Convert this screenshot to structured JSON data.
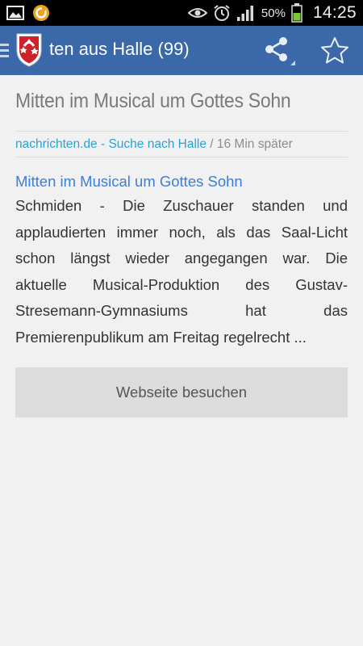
{
  "status_bar": {
    "battery_percent": "50%",
    "time": "14:25",
    "icons": [
      "gallery-icon",
      "app-notification-icon",
      "eye-icon",
      "alarm-icon",
      "signal-icon",
      "battery-icon"
    ]
  },
  "action_bar": {
    "title": "ten aus Halle (99)",
    "logo": "halle-coat-of-arms-logo",
    "actions": [
      "share-icon",
      "star-icon"
    ],
    "color": "#3a68a8"
  },
  "article": {
    "heading": "Mitten im Musical um Gottes Sohn",
    "source": "nachrichten.de - Suche nach Halle",
    "separator": " / ",
    "time_ago": "16 Min später",
    "link_title": "Mitten im Musical um Gottes Sohn",
    "body": "Schmiden - Die Zuschauer standen und applaudierten immer noch, als das Saal-Licht schon längst wieder angegangen war. Die aktuelle Musical-Produktion des Gustav-Stresemann-Gymnasiums hat das Premierenpublikum am Freitag regelrecht ..."
  },
  "buttons": {
    "visit_website": "Webseite besuchen"
  },
  "colors": {
    "link": "#3d7ed6",
    "source": "#2aa3d4",
    "background": "#f1f1f1"
  }
}
